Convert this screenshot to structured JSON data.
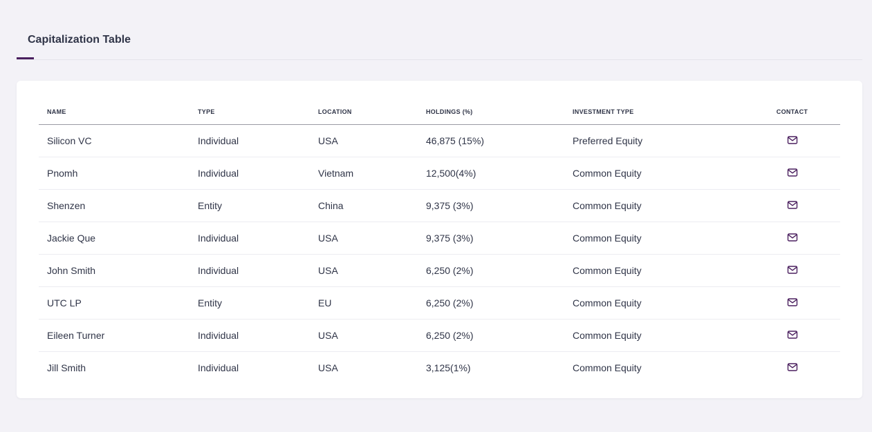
{
  "tabs": [
    {
      "label": "Capitalization Table",
      "active": true
    }
  ],
  "colors": {
    "accent": "#4a1f5e",
    "background": "#f3f2f7",
    "text": "#2f3447"
  },
  "table": {
    "headers": {
      "name": "NAME",
      "type": "TYPE",
      "location": "LOCATION",
      "holdings": "HOLDINGS (%)",
      "investment_type": "INVESTMENT TYPE",
      "contact": "CONTACT"
    },
    "contact_icon": "mail-icon",
    "rows": [
      {
        "name": "Silicon VC",
        "type": "Individual",
        "location": "USA",
        "holdings": "46,875 (15%)",
        "investment_type": "Preferred Equity"
      },
      {
        "name": "Pnomh",
        "type": "Individual",
        "location": "Vietnam",
        "holdings": "12,500(4%)",
        "investment_type": "Common Equity"
      },
      {
        "name": "Shenzen",
        "type": "Entity",
        "location": "China",
        "holdings": "9,375 (3%)",
        "investment_type": "Common Equity"
      },
      {
        "name": "Jackie Que",
        "type": "Individual",
        "location": "USA",
        "holdings": "9,375 (3%)",
        "investment_type": "Common Equity"
      },
      {
        "name": "John Smith",
        "type": "Individual",
        "location": "USA",
        "holdings": "6,250 (2%)",
        "investment_type": "Common Equity"
      },
      {
        "name": "UTC LP",
        "type": "Entity",
        "location": "EU",
        "holdings": "6,250 (2%)",
        "investment_type": "Common Equity"
      },
      {
        "name": "Eileen Turner",
        "type": "Individual",
        "location": "USA",
        "holdings": "6,250 (2%)",
        "investment_type": "Common Equity"
      },
      {
        "name": "Jill Smith",
        "type": "Individual",
        "location": "USA",
        "holdings": "3,125(1%)",
        "investment_type": "Common Equity"
      }
    ]
  }
}
